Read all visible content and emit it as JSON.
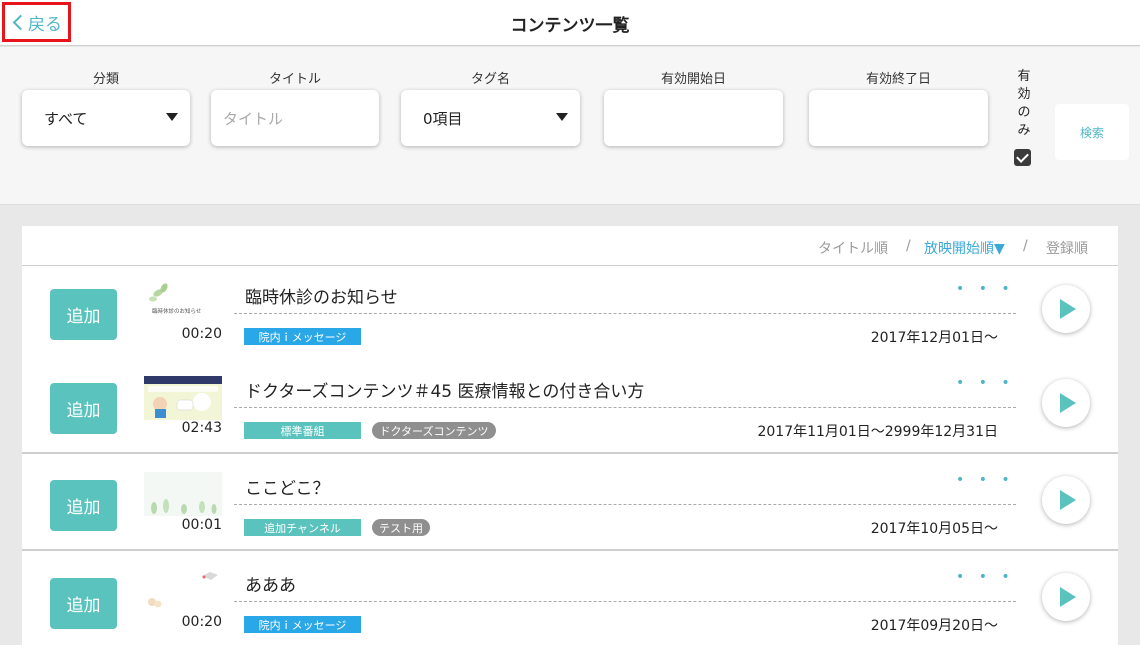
{
  "header": {
    "back_label": "戻る",
    "title": "コンテンツ一覧"
  },
  "filters": {
    "category": {
      "label": "分類",
      "value": "すべて"
    },
    "title": {
      "label": "タイトル",
      "placeholder": "タイトル"
    },
    "tag": {
      "label": "タグ名",
      "value": "0項目"
    },
    "start_date": {
      "label": "有効開始日",
      "value": ""
    },
    "end_date": {
      "label": "有効終了日",
      "value": ""
    },
    "valid_only": {
      "label": "有効のみ",
      "checked": true
    },
    "search_label": "検索"
  },
  "sort": {
    "title_order": "タイトル順",
    "sep1": "/",
    "start_order": "放映開始順▼",
    "sep2": "/",
    "registered_order": "登録順",
    "active": "start_order"
  },
  "colors": {
    "accent_teal": "#5bc3bd",
    "accent_blue": "#3aa9d8",
    "tag_blue": "#2aa7e6",
    "tag_teal": "#5bc3bd",
    "tag_gray": "#8f8f8f",
    "highlight_red": "#e8141b"
  },
  "items": [
    {
      "add_label": "追加",
      "duration": "00:20",
      "title": "臨時休診のお知らせ",
      "thumb_text": "臨時休診のお知らせ",
      "more": "• • •",
      "tags": [
        {
          "label": "院内ｉメッセージ",
          "style": "blue"
        }
      ],
      "date": "2017年12月01日〜"
    },
    {
      "add_label": "追加",
      "duration": "02:43",
      "title": "ドクターズコンテンツ＃45 医療情報との付き合い方",
      "thumb_text": "",
      "more": "• • •",
      "tags": [
        {
          "label": "標準番組",
          "style": "teal"
        },
        {
          "label": "ドクターズコンテンツ",
          "style": "gray"
        }
      ],
      "date": "2017年11月01日〜2999年12月31日"
    },
    {
      "add_label": "追加",
      "duration": "00:01",
      "title": "ここどこ？",
      "thumb_text": "",
      "more": "• • •",
      "tags": [
        {
          "label": "追加チャンネル",
          "style": "teal"
        },
        {
          "label": "テスト用",
          "style": "gray"
        }
      ],
      "date": "2017年10月05日〜"
    },
    {
      "add_label": "追加",
      "duration": "00:20",
      "title": "あああ",
      "thumb_text": "",
      "more": "• • •",
      "tags": [
        {
          "label": "院内ｉメッセージ",
          "style": "blue"
        }
      ],
      "date": "2017年09月20日〜"
    }
  ]
}
